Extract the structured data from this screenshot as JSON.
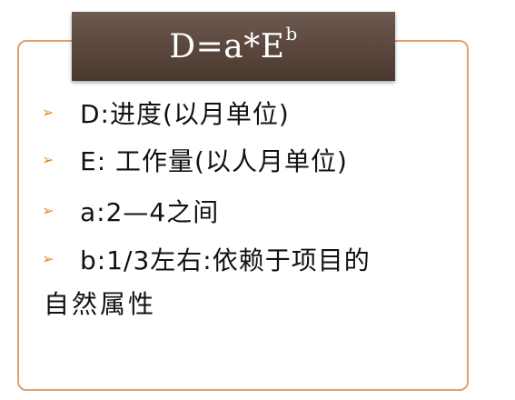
{
  "slide": {
    "title_main": "D=a*E",
    "title_sup": "b",
    "bullet_symbol": "➢",
    "bullets": [
      {
        "text": "D:进度(以月单位)"
      },
      {
        "text": "E: 工作量(以人月单位)"
      },
      {
        "text": "a:2—4之间"
      },
      {
        "text": "b:1/3左右:依赖于项目的"
      }
    ],
    "continuation": "自然属性"
  },
  "colors": {
    "frame_border": "#e0a070",
    "banner_bg": "#5a463c",
    "bullet_arrow": "#e08a2a",
    "text": "#111111"
  }
}
